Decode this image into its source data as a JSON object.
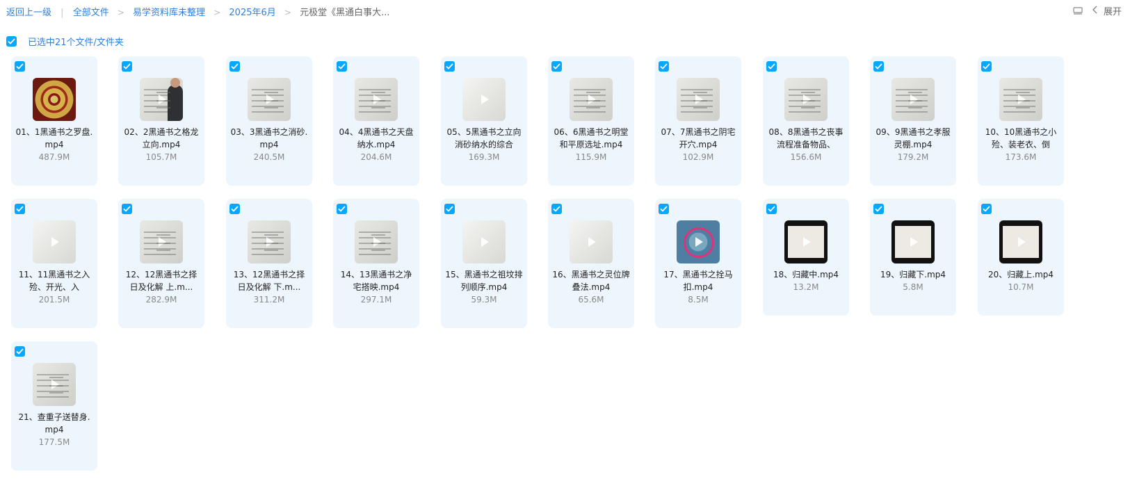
{
  "breadcrumb": {
    "back": "返回上一级",
    "items": [
      "全部文件",
      "易学资料库未整理",
      "2025年6月"
    ],
    "current": "元极堂《黑通白事大..."
  },
  "top_right": {
    "list_icon": "list-view-icon",
    "expand_label": "展开"
  },
  "selection": {
    "label": "已选中21个文件/文件夹"
  },
  "files": [
    {
      "name": "01、1黑通书之罗盘.mp4",
      "size": "487.9M",
      "thumb": "compass"
    },
    {
      "name": "02、2黑通书之格龙立向.mp4",
      "size": "105.7M",
      "thumb": "person"
    },
    {
      "name": "03、3黑通书之消砂.mp4",
      "size": "240.5M",
      "thumb": "board"
    },
    {
      "name": "04、4黑通书之天盘纳水.mp4",
      "size": "204.6M",
      "thumb": "board"
    },
    {
      "name": "05、5黑通书之立向消砂纳水的综合",
      "size": "169.3M",
      "thumb": "white"
    },
    {
      "name": "06、6黑通书之明堂和平原选址.mp4",
      "size": "115.9M",
      "thumb": "board"
    },
    {
      "name": "07、7黑通书之阴宅开穴.mp4",
      "size": "102.9M",
      "thumb": "board"
    },
    {
      "name": "08、8黑通书之丧事流程准备物品、",
      "size": "156.6M",
      "thumb": "board"
    },
    {
      "name": "09、9黑通书之孝服灵棚.mp4",
      "size": "179.2M",
      "thumb": "board"
    },
    {
      "name": "10、10黑通书之小殓、装老衣、倒",
      "size": "173.6M",
      "thumb": "board"
    },
    {
      "name": "11、11黑通书之入殓、开光、入",
      "size": "201.5M",
      "thumb": "white"
    },
    {
      "name": "12、12黑通书之择日及化解 上.m...",
      "size": "282.9M",
      "thumb": "board"
    },
    {
      "name": "13、12黑通书之择日及化解 下.m...",
      "size": "311.2M",
      "thumb": "board"
    },
    {
      "name": "14、13黑通书之净宅搭映.mp4",
      "size": "297.1M",
      "thumb": "board"
    },
    {
      "name": "15、黑通书之祖坟排列顺序.mp4",
      "size": "59.3M",
      "thumb": "white"
    },
    {
      "name": "16、黑通书之灵位牌叠法.mp4",
      "size": "65.6M",
      "thumb": "white"
    },
    {
      "name": "17、黑通书之拴马扣.mp4",
      "size": "8.5M",
      "thumb": "rope"
    },
    {
      "name": "18、归藏中.mp4",
      "size": "13.2M",
      "thumb": "dark"
    },
    {
      "name": "19、归藏下.mp4",
      "size": "5.8M",
      "thumb": "dark"
    },
    {
      "name": "20、归藏上.mp4",
      "size": "10.7M",
      "thumb": "dark"
    },
    {
      "name": "21、查重子送替身.mp4",
      "size": "177.5M",
      "thumb": "board"
    }
  ],
  "colors": {
    "accent": "#06a7ff",
    "link": "#2f7fe0",
    "card_bg": "#eef6fd"
  }
}
